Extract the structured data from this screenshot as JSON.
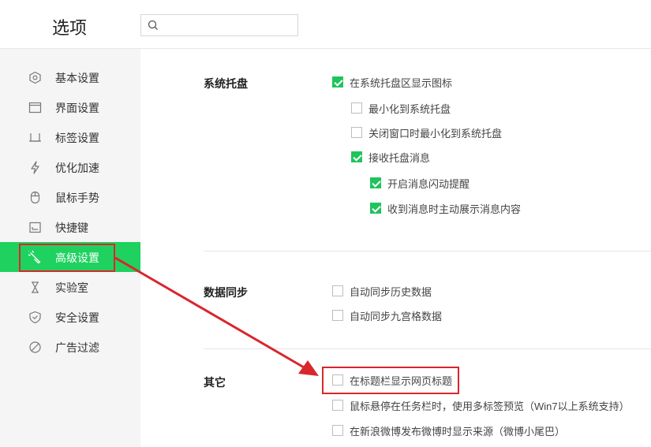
{
  "header": {
    "title": "选项",
    "search_placeholder": ""
  },
  "sidebar": {
    "items": [
      {
        "label": "基本设置",
        "icon": "hexagon-icon"
      },
      {
        "label": "界面设置",
        "icon": "window-icon"
      },
      {
        "label": "标签设置",
        "icon": "tab-icon"
      },
      {
        "label": "优化加速",
        "icon": "lightning-icon"
      },
      {
        "label": "鼠标手势",
        "icon": "mouse-icon"
      },
      {
        "label": "快捷键",
        "icon": "keyboard-icon"
      },
      {
        "label": "高级设置",
        "icon": "wrench-icon",
        "active": true
      },
      {
        "label": "实验室",
        "icon": "flask-icon"
      },
      {
        "label": "安全设置",
        "icon": "shield-icon"
      },
      {
        "label": "广告过滤",
        "icon": "block-icon"
      }
    ]
  },
  "sections": {
    "tray": {
      "title": "系统托盘",
      "options": [
        {
          "label": "在系统托盘区显示图标",
          "checked": true
        },
        {
          "label": "最小化到系统托盘",
          "checked": false
        },
        {
          "label": "关闭窗口时最小化到系统托盘",
          "checked": false
        },
        {
          "label": "接收托盘消息",
          "checked": true
        },
        {
          "label": "开启消息闪动提醒",
          "checked": true
        },
        {
          "label": "收到消息时主动展示消息内容",
          "checked": true
        }
      ]
    },
    "sync": {
      "title": "数据同步",
      "options": [
        {
          "label": "自动同步历史数据",
          "checked": false
        },
        {
          "label": "自动同步九宫格数据",
          "checked": false
        }
      ]
    },
    "other": {
      "title": "其它",
      "options": [
        {
          "label": "在标题栏显示网页标题",
          "checked": false
        },
        {
          "label": "鼠标悬停在任务栏时，使用多标签预览（Win7以上系统支持）",
          "checked": false
        },
        {
          "label": "在新浪微博发布微博时显示来源（微博小尾巴）",
          "checked": false
        }
      ]
    }
  },
  "colors": {
    "accent": "#1fd15f",
    "annotation": "#d9262c"
  }
}
